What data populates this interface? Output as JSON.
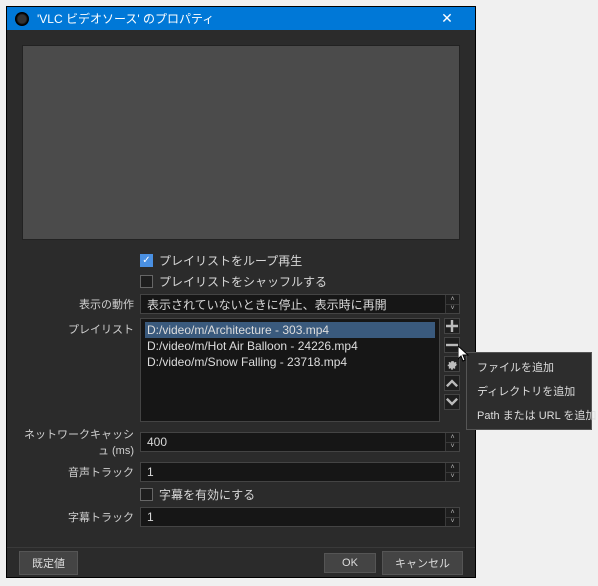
{
  "titlebar": {
    "title": "'VLC ビデオソース' のプロパティ"
  },
  "checks": {
    "loop": {
      "label": "プレイリストをループ再生",
      "checked": true
    },
    "shuffle": {
      "label": "プレイリストをシャッフルする",
      "checked": false
    },
    "subs": {
      "label": "字幕を有効にする",
      "checked": false
    }
  },
  "labels": {
    "visibility": "表示の動作",
    "playlist": "プレイリスト",
    "netcache": "ネットワークキャッシュ (ms)",
    "audiotrack": "音声トラック",
    "subtrack": "字幕トラック"
  },
  "visibility_value": "表示されていないときに停止、表示時に再開",
  "playlist_items": [
    "D:/video/m/Architecture - 303.mp4",
    "D:/video/m/Hot Air Balloon - 24226.mp4",
    "D:/video/m/Snow Falling - 23718.mp4"
  ],
  "netcache": "400",
  "audiotrack": "1",
  "subtrack": "1",
  "buttons": {
    "defaults": "既定値",
    "ok": "OK",
    "cancel": "キャンセル"
  },
  "ctx": {
    "add_file": "ファイルを追加",
    "add_dir": "ディレクトリを追加",
    "add_url": "Path または URL を追加"
  }
}
